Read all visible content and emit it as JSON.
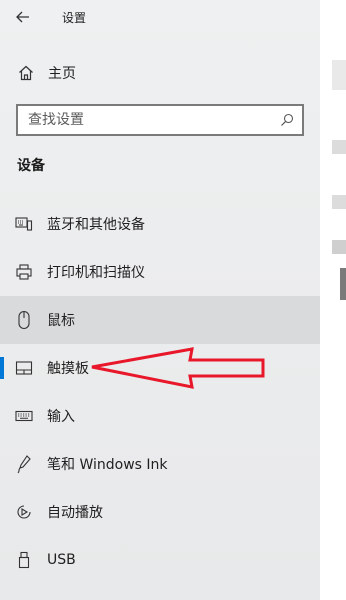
{
  "titlebar": {
    "back_icon": "back-arrow-icon",
    "title": "设置"
  },
  "home": {
    "icon": "home-icon",
    "label": "主页"
  },
  "search": {
    "placeholder": "查找设置",
    "icon": "search-icon"
  },
  "section": {
    "title": "设备"
  },
  "nav": [
    {
      "icon": "bluetooth-devices-icon",
      "label": "蓝牙和其他设备",
      "state": "normal"
    },
    {
      "icon": "printer-icon",
      "label": "打印机和扫描仪",
      "state": "normal"
    },
    {
      "icon": "mouse-icon",
      "label": "鼠标",
      "state": "hover"
    },
    {
      "icon": "touchpad-icon",
      "label": "触摸板",
      "state": "selected"
    },
    {
      "icon": "keyboard-icon",
      "label": "输入",
      "state": "normal"
    },
    {
      "icon": "pen-icon",
      "label": "笔和 Windows Ink",
      "state": "normal"
    },
    {
      "icon": "autoplay-icon",
      "label": "自动播放",
      "state": "normal"
    },
    {
      "icon": "usb-icon",
      "label": "USB",
      "state": "normal"
    }
  ],
  "colors": {
    "accent": "#0078d7",
    "annotation_arrow": "#e8182a",
    "sidebar_bg": "#eceeef",
    "hover_bg": "#d9dadb"
  }
}
